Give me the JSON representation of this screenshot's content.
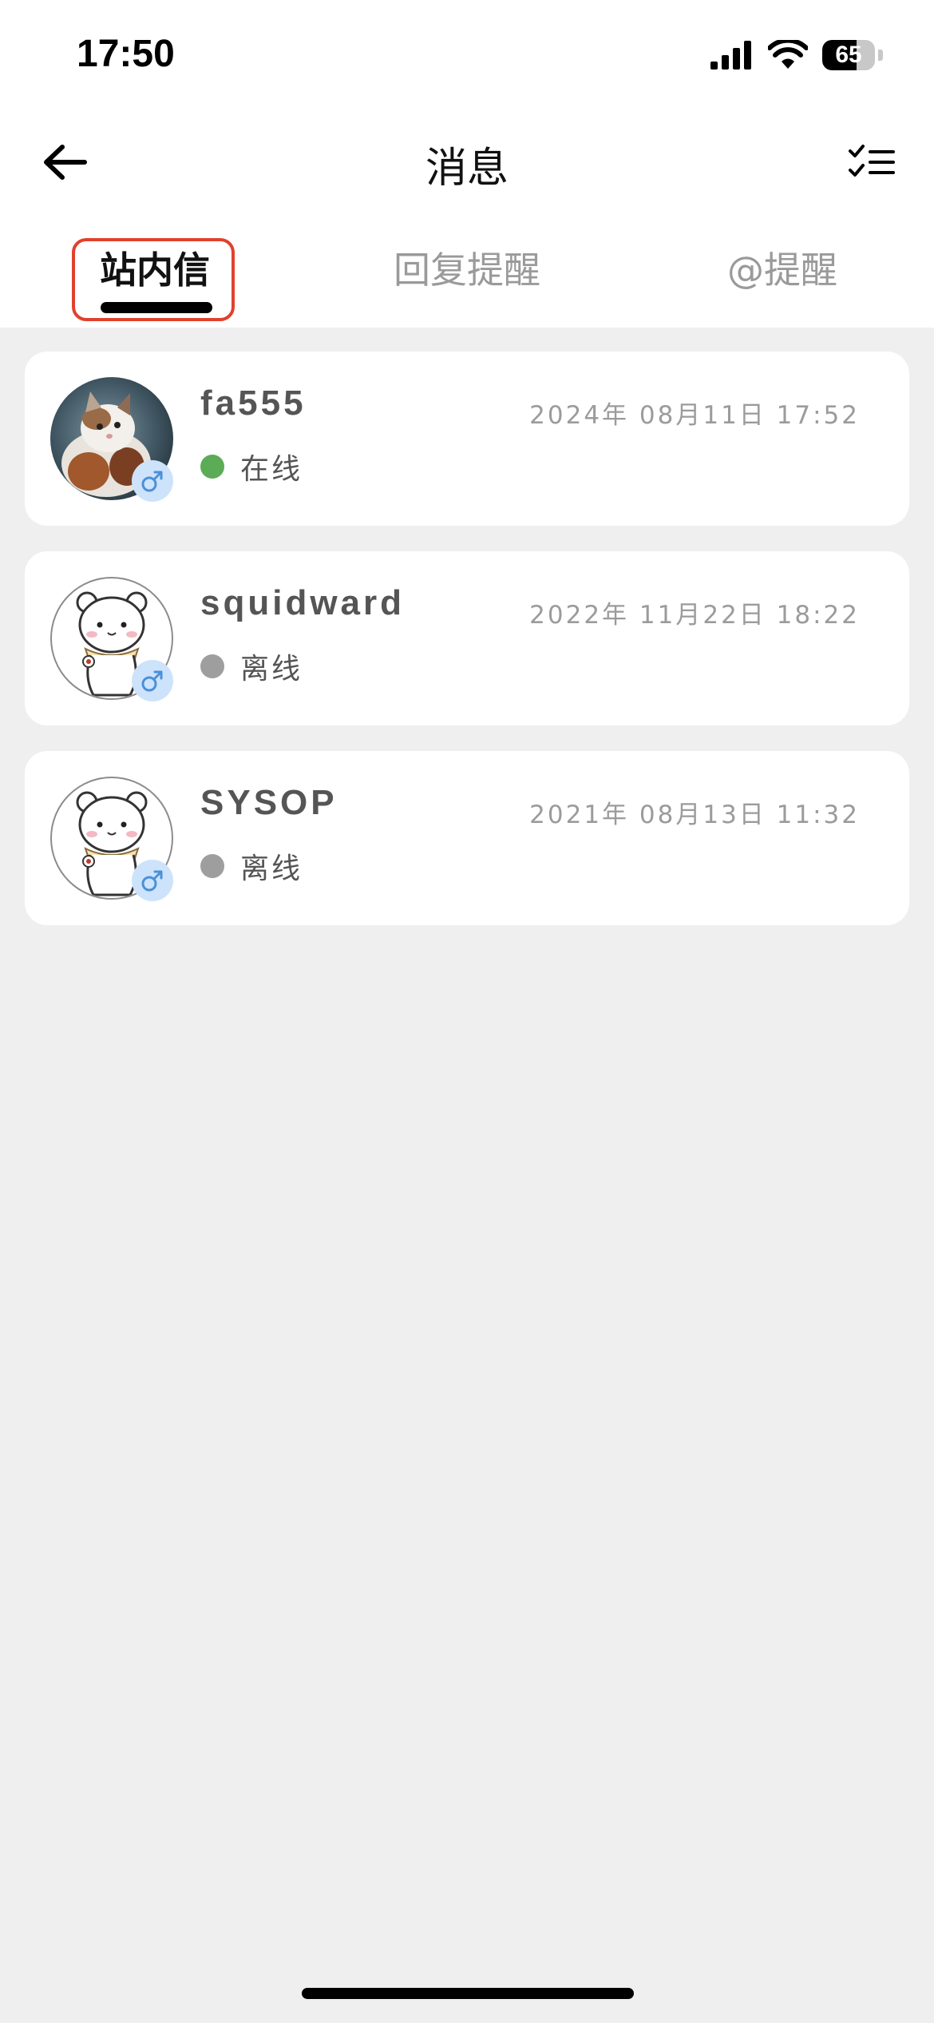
{
  "status_bar": {
    "time": "17:50",
    "battery_text": "65",
    "battery_level": 0.65,
    "icons": [
      "signal-icon",
      "wifi-icon",
      "battery-icon"
    ]
  },
  "nav": {
    "title": "消息",
    "back_icon": "arrow-left-icon",
    "action_icon": "checklist-icon"
  },
  "tabs": [
    {
      "label": "站内信",
      "active": true
    },
    {
      "label": "回复提醒",
      "active": false
    },
    {
      "label": "@提醒",
      "active": false
    }
  ],
  "colors": {
    "highlight_border": "#e0412e",
    "online": "#5bab57",
    "offline": "#9e9e9e",
    "gender_badge_bg": "#cde3fb",
    "gender_icon": "#4a90d9",
    "page_bg": "#efefef"
  },
  "conversations": [
    {
      "username": "fa555",
      "timestamp": "2024年 08月11日 17:52",
      "status": "在线",
      "online": true,
      "avatar": "cat-avatar",
      "gender": "male-icon"
    },
    {
      "username": "squidward",
      "timestamp": "2022年 11月22日 18:22",
      "status": "离线",
      "online": false,
      "avatar": "bear-avatar",
      "gender": "male-icon"
    },
    {
      "username": "SYSOP",
      "timestamp": "2021年 08月13日 11:32",
      "status": "离线",
      "online": false,
      "avatar": "bear-avatar",
      "gender": "male-icon"
    }
  ]
}
